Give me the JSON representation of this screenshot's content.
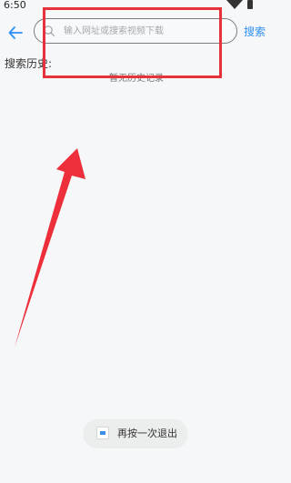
{
  "status_bar": {
    "time": "6:50"
  },
  "header": {
    "search_placeholder": "输入网址或搜索视频下载",
    "search_value": "",
    "search_button_label": "搜索"
  },
  "history": {
    "label": "搜索历史:",
    "empty_text": "暂无历史记录"
  },
  "toast": {
    "message": "再按一次退出"
  },
  "colors": {
    "accent": "#2f8ff5",
    "annotation": "#e8323b",
    "background": "#f6f7f8"
  },
  "icons": {
    "back": "arrow-left-icon",
    "search": "search-icon",
    "wifi": "wifi-icon",
    "battery": "battery-icon"
  }
}
